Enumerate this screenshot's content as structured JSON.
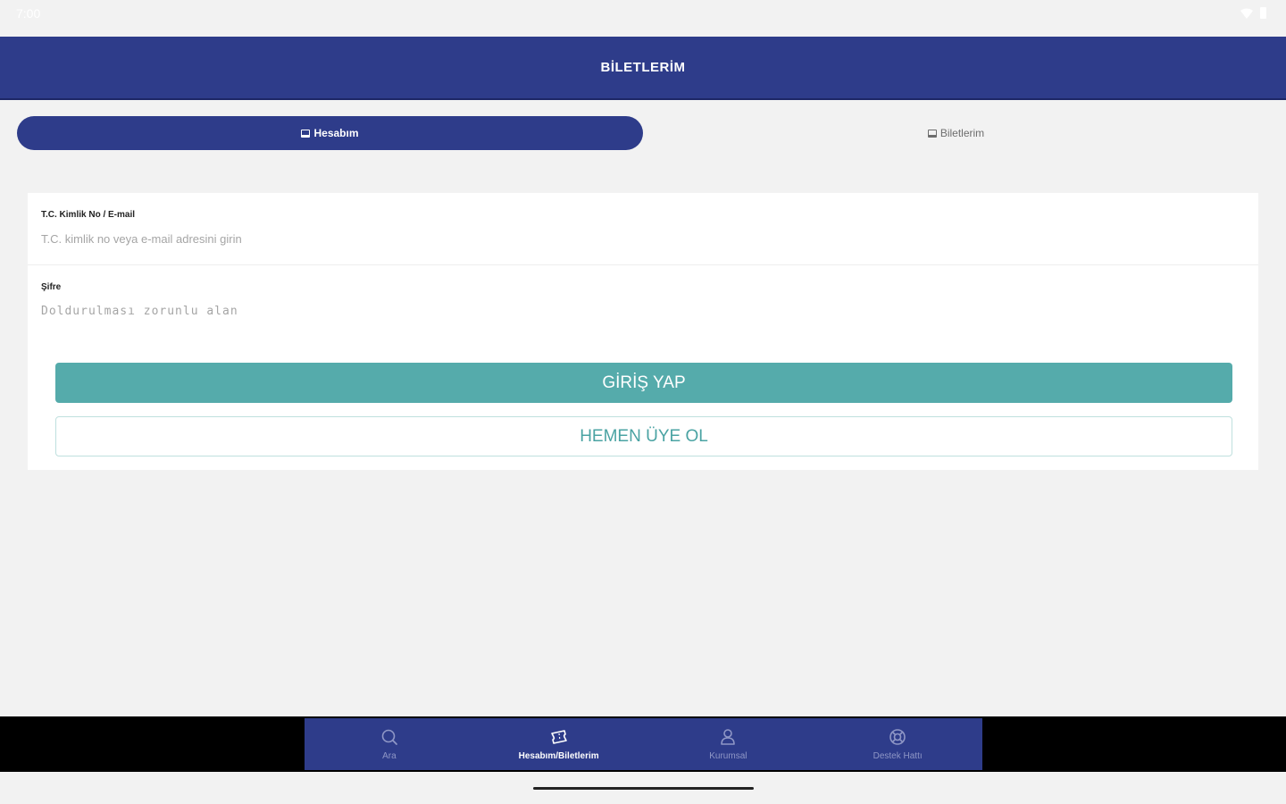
{
  "status_bar": {
    "time": "7:00",
    "icons": [
      "wifi-icon",
      "battery-icon"
    ]
  },
  "header": {
    "title": "BİLETLERİM"
  },
  "tabs": [
    {
      "label": "Hesabım",
      "icon": "ticket-icon",
      "active": true
    },
    {
      "label": "Biletlerim",
      "icon": "ticket-icon",
      "active": false
    }
  ],
  "form": {
    "id_field": {
      "label": "T.C. Kimlik No / E-mail",
      "placeholder": "T.C. kimlik no veya e-mail adresini girin",
      "value": ""
    },
    "password_field": {
      "label": "Şifre",
      "placeholder": "Doldurulması zorunlu alan",
      "value": ""
    },
    "login_button": "GİRİŞ YAP",
    "register_button": "HEMEN ÜYE OL"
  },
  "bottom_nav": [
    {
      "label": "Ara",
      "icon": "search-icon",
      "active": false
    },
    {
      "label": "Hesabım/Biletlerim",
      "icon": "ticket-icon",
      "active": true
    },
    {
      "label": "Kurumsal",
      "icon": "person-icon",
      "active": false
    },
    {
      "label": "Destek Hattı",
      "icon": "support-icon",
      "active": false
    }
  ],
  "colors": {
    "primary": "#2e3c8a",
    "accent": "#55abab",
    "background": "#f2f2f2"
  }
}
